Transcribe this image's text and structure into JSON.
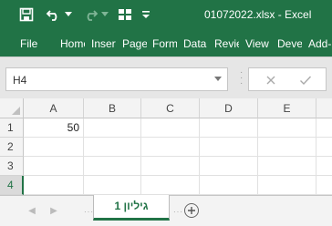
{
  "window": {
    "title": "01072022.xlsx  -  Excel"
  },
  "quick_access": {
    "save_icon": "save-icon",
    "undo_icon": "undo-icon",
    "redo_icon": "redo-icon",
    "customize_icon": "customize-qat-icon"
  },
  "ribbon": {
    "tabs": [
      "File",
      "Home",
      "Insert",
      "Page Layout",
      "Formulas",
      "Data",
      "Review",
      "View",
      "Developer",
      "Add-ins"
    ]
  },
  "formula_bar": {
    "name_box": "H4",
    "cancel_icon": "close-icon",
    "enter_icon": "check-icon",
    "formula_value": ""
  },
  "grid": {
    "columns": [
      "A",
      "B",
      "C",
      "D",
      "E"
    ],
    "rows": [
      "1",
      "2",
      "3",
      "4"
    ],
    "active_row": "4",
    "cells": {
      "A1": "50"
    }
  },
  "sheets": {
    "tabs": [
      "גיליון 1"
    ],
    "active": "גיליון 1",
    "add_icon": "plus-icon"
  },
  "colors": {
    "brand": "#217346",
    "header_bg": "#f3f3f3"
  }
}
